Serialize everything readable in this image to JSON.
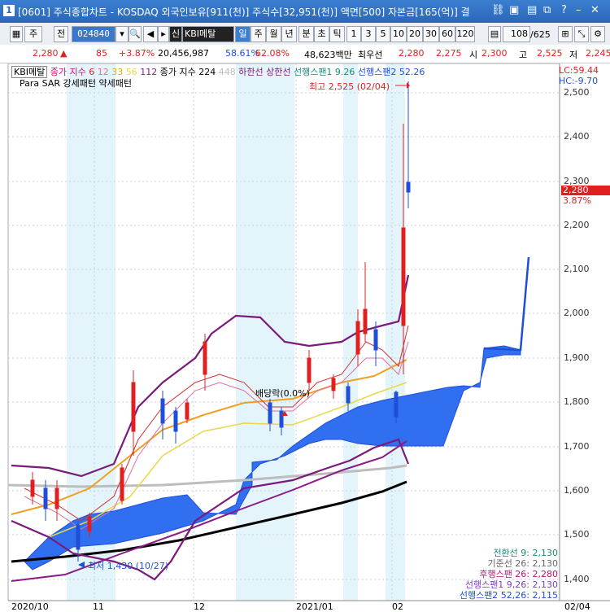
{
  "window": {
    "number": "1",
    "title": "[0601] 주식종합차트 - KOSDAQ 외국인보유[911(천)] 주식수[32,951(천)] 액면[500] 자본금[165(억)] 결"
  },
  "toolbar": {
    "code_label_1": "주",
    "code_label_2": "전",
    "stock_code": "024840",
    "stock_name": "KBI메탈",
    "badge_sin": "신",
    "periods": [
      "일",
      "주",
      "월",
      "년",
      "분",
      "초",
      "틱"
    ],
    "intervals": [
      "1",
      "3",
      "5",
      "10",
      "20",
      "30",
      "60",
      "120"
    ],
    "count": "108",
    "total": "/625"
  },
  "info": {
    "price": "2,280",
    "change": "85",
    "pct": "+3.87%",
    "volume": "20,456,987",
    "ratio1": "58.61%",
    "ratio2": "62.08%",
    "amount": "48,623백만",
    "rank_label": "최우선",
    "ask": "2,280",
    "bid": "2,275",
    "open_label": "시",
    "open": "2,300",
    "high_label": "고",
    "high": "2,525",
    "low_label": "저",
    "low": "2,245"
  },
  "legend": {
    "name": "KBI메탈",
    "ma_label": "종가 지수",
    "ma6": "6",
    "ma12": "12",
    "ma33": "33",
    "ma56": "56",
    "ma112": "112",
    "ma224_label": "종가 지수 224",
    "ma448": "448",
    "lower": "하한선",
    "upper": "상한선",
    "span1": "선행스팬1 9.26",
    "span2": "선행스팬2 52.26",
    "lc": "LC:59.44",
    "hc": "HC:-9.70",
    "sar": "Para SAR 강세패턴",
    "weak": "약세패턴"
  },
  "annotations": {
    "high": "최고 2,525 (02/04)",
    "low": "최저 1,430 (10/27)",
    "event": "배당락(0.0%)",
    "current_price": "2,280",
    "current_pct": "3.87%"
  },
  "yaxis": [
    "2,500",
    "2,400",
    "2,300",
    "2,200",
    "2,100",
    "2,000",
    "1,900",
    "1,800",
    "1,700",
    "1,600",
    "1,500",
    "1,400"
  ],
  "xaxis": [
    "2020/10",
    "11",
    "12",
    "2021/01",
    "02",
    "02/04"
  ],
  "ichimoku": [
    {
      "text": "전환선 9: 2,130",
      "color": "#1a8a7a"
    },
    {
      "text": "기준선 26: 2,130",
      "color": "#666666"
    },
    {
      "text": "후행스팬 26: 2,280",
      "color": "#c01070"
    },
    {
      "text": "선행스팬1 9,26: 2,130",
      "color": "#8040c0"
    },
    {
      "text": "선행스팬2 52,26: 2,115",
      "color": "#1f4fd8"
    }
  ]
}
